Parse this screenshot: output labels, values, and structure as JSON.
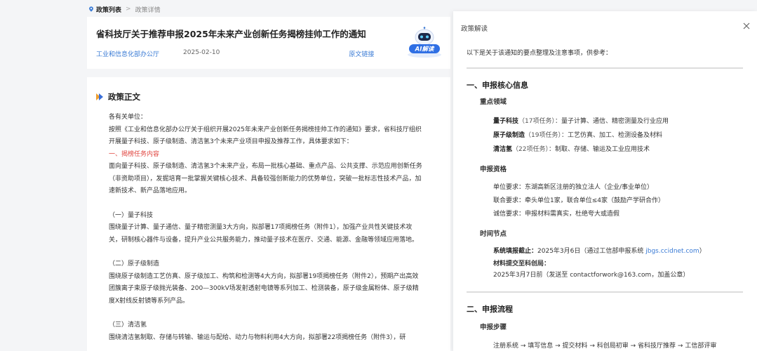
{
  "breadcrumb": {
    "root": "政策列表",
    "sep": ">",
    "current": "政策详情"
  },
  "header": {
    "title": "省科技厅关于推荐申报2025年未来产业创新任务揭榜挂帅工作的通知",
    "source": "工业和信息化部办公厅",
    "date": "2025-02-10",
    "origin_link": "原文链接",
    "ai_label": "AI解读"
  },
  "body": {
    "section_title": "政策正文",
    "paragraphs": [
      {
        "text": "各有关单位：",
        "style": "normal"
      },
      {
        "text": "按照《工业和信息化部办公厅关于组织开展2025年未来产业创新任务揭榜挂帅工作的通知》要求，省科技厅组织开展量子科技、原子级制造、清洁氢3个未来产业项目申报及推荐工作，具体要求如下：",
        "style": "normal"
      },
      {
        "text": "一、揭榜任务内容",
        "style": "red"
      },
      {
        "text": "面向量子科技、原子级制造、清洁氢3个未来产业，布局一批核心基础、重点产品、公共支撑、示范应用创新任务（非资助项目），发掘培育一批掌握关键核心技术、具备较强创新能力的优势单位，突破一批标志性技术产品，加速新技术、新产品落地应用。",
        "style": "normal"
      },
      {
        "text": "",
        "style": "gap"
      },
      {
        "text": "（一）量子科技",
        "style": "normal"
      },
      {
        "text": "围绕量子计算、量子通信、量子精密测量3大方向，拟部署17项揭榜任务（附件1），加强产业共性关键技术攻关，研制核心器件与设备，提升产业公共服务能力，推动量子技术在医疗、交通、能源、金融等领域应用落地。",
        "style": "normal"
      },
      {
        "text": "",
        "style": "gap"
      },
      {
        "text": "（二）原子级制造",
        "style": "normal"
      },
      {
        "text": "围绕原子级制造工艺仿真、原子级加工、构筑和检测等4大方向，拟部署19项揭榜任务（附件2），预期产出高效团簇离子束原子级抛光装备、200—300kV场发射透射电镜等系列加工、检测装备，原子级金属粉体、原子级精度X射线反射镜等系列产品。",
        "style": "normal"
      },
      {
        "text": "",
        "style": "gap"
      },
      {
        "text": "（三）清洁氢",
        "style": "normal"
      },
      {
        "text": "围绕清洁氢制取、存储与转输、输运与配给、动力与物料利用4大方向，拟部署22项揭榜任务（附件3），研",
        "style": "normal"
      }
    ]
  },
  "panel": {
    "title": "政策解读",
    "intro": "以下是关于该通知的要点整理及注意事项，供参考：",
    "s1_title": "一、申报核心信息",
    "focus_title": "重点领域",
    "focus": [
      {
        "name": "量子科技",
        "count": "（17项任务）：",
        "desc": "量子计算、通信、精密测量及行业应用"
      },
      {
        "name": "原子级制造",
        "count": "（19项任务）：",
        "desc": "工艺仿真、加工、检测设备及材料"
      },
      {
        "name": "清洁氢",
        "count": "（22项任务）：",
        "desc": "制取、存储、输运及工业应用技术"
      }
    ],
    "qual_title": "申报资格",
    "qual": [
      "单位要求：东湖高新区注册的独立法人（企业/事业单位）",
      "联合要求：牵头单位1家，联合单位≤4家（鼓励产学研合作）",
      "诚信要求：申报材料需真实，杜绝夸大或造假"
    ],
    "time_title": "时间节点",
    "deadline_label": "系统填报截止：",
    "deadline_text": "2025年3月6日（通过工信部申报系统 ",
    "deadline_link": "jbgs.ccidnet.com",
    "deadline_end": "）",
    "submit_label": "材料提交至科创局：",
    "submit_text": "2025年3月7日前（发送至 contactforwork@163.com，加盖公章）",
    "s2_title": "二、申报流程",
    "steps_title": "申报步骤",
    "steps": "注册系统 → 填写信息 → 提交材料 → 科创局初审 → 省科技厅推荐 → 工信部评审"
  }
}
